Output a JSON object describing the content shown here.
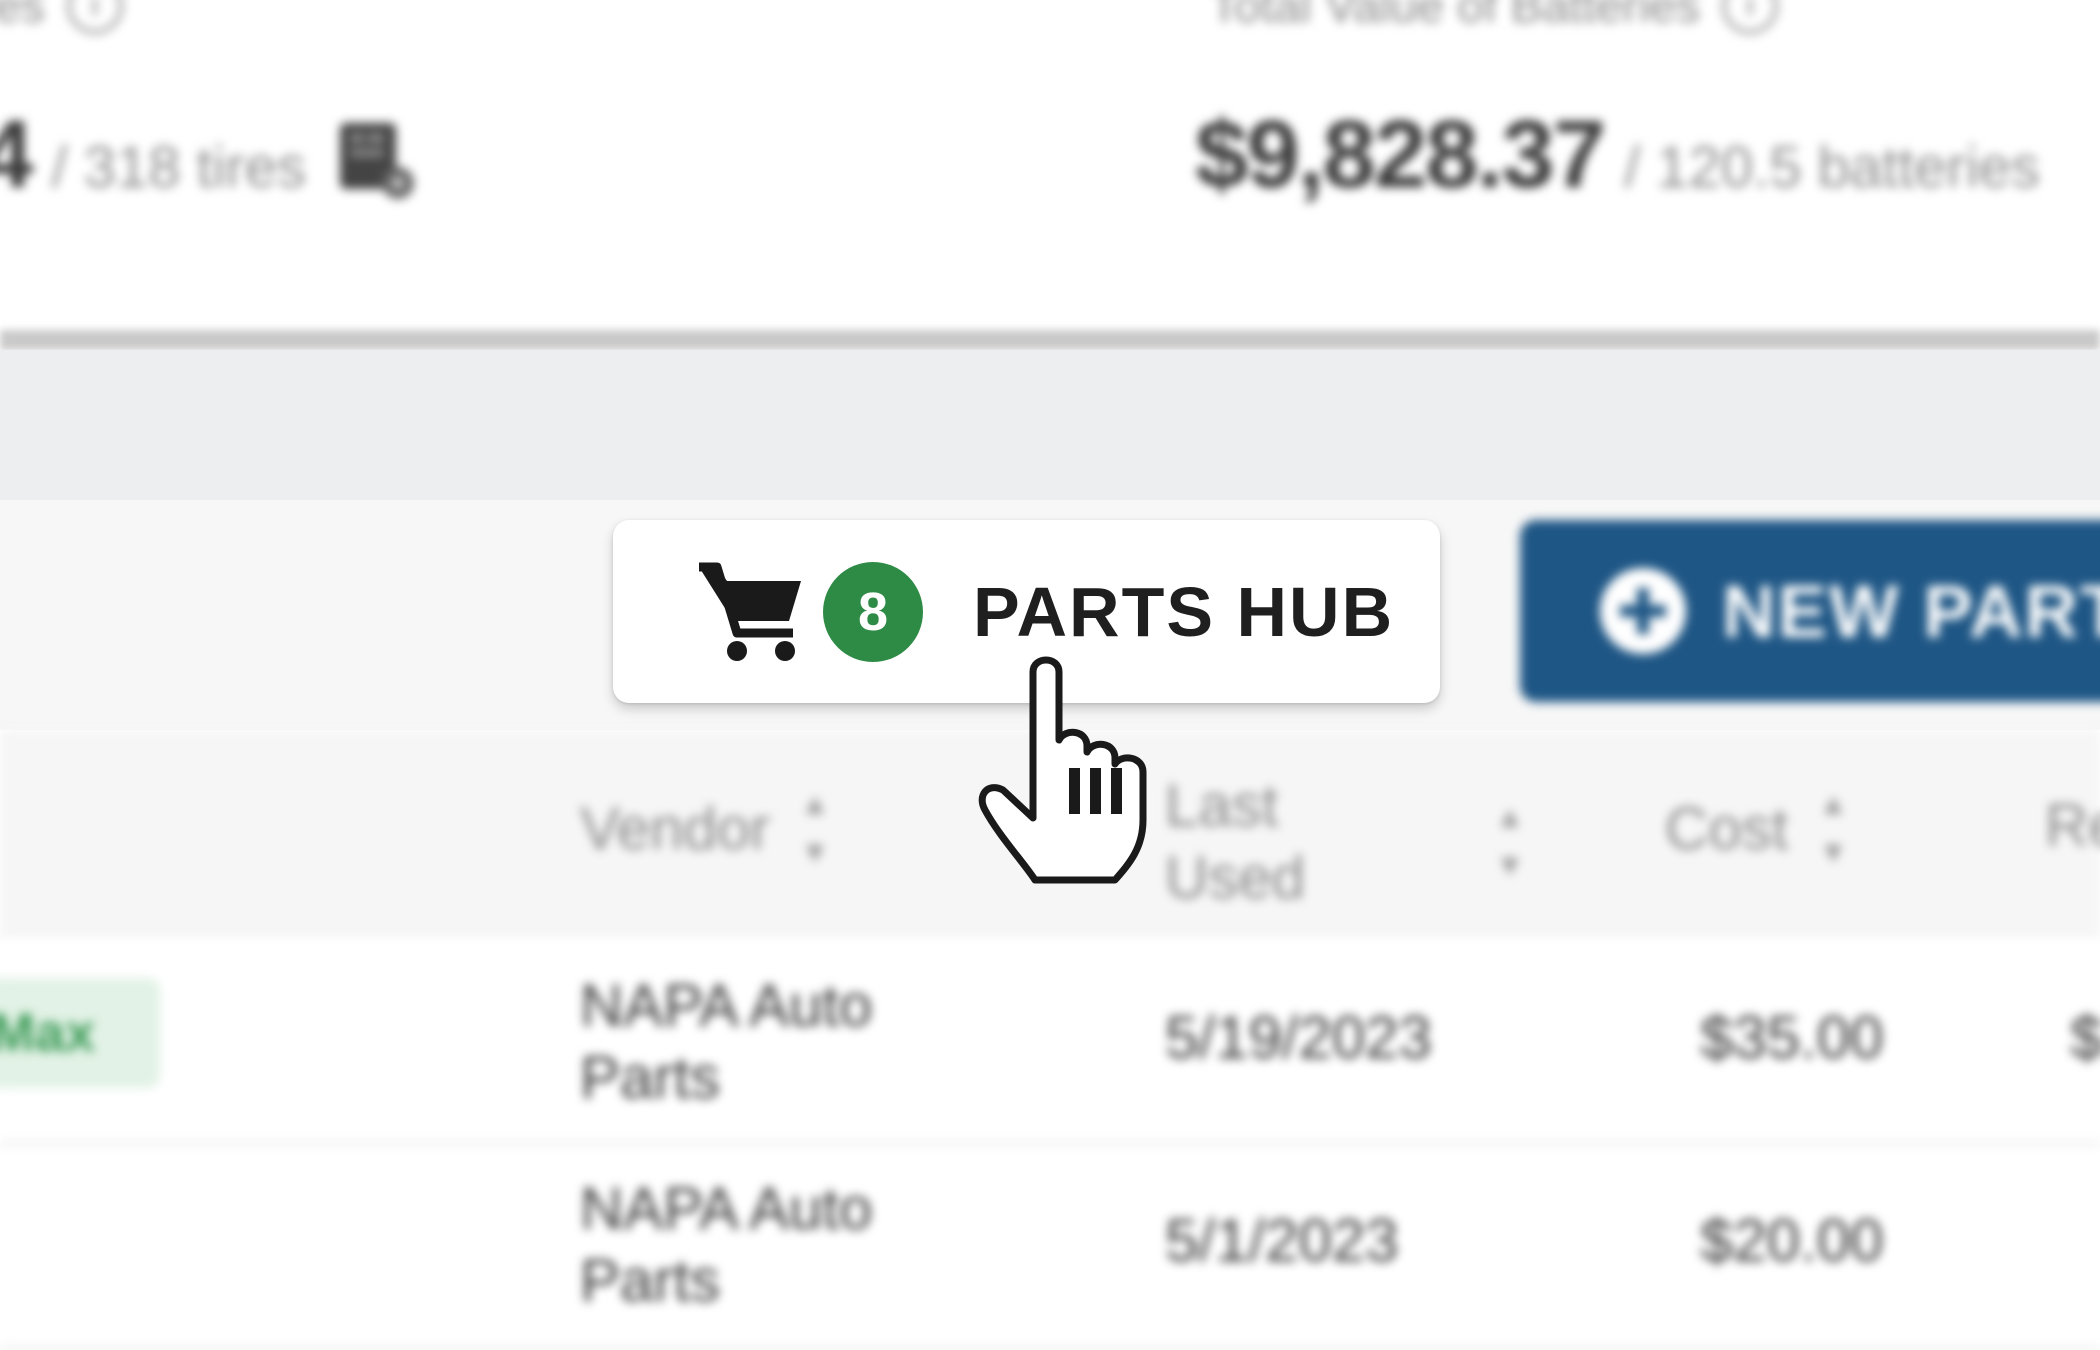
{
  "stats": {
    "tires": {
      "heading": "Tires",
      "value": "4",
      "sub": "/ 318 tires",
      "info_icon": "info-circle-icon",
      "icon": "tire-icon"
    },
    "batteries": {
      "heading": "Total Value of Batteries",
      "value": "$9,828.37",
      "sub": "/ 120.5 batteries",
      "info_icon": "info-circle-icon"
    }
  },
  "toolbar": {
    "parts_hub": {
      "label": "PARTS HUB",
      "badge_count": "8",
      "icon": "shopping-cart-icon",
      "badge_color": "#2e8b46"
    },
    "new_part": {
      "label": "NEW PART",
      "icon": "plus-circle-icon",
      "color": "#1e5685"
    }
  },
  "table": {
    "columns": [
      {
        "key": "vendor",
        "label": "Vendor"
      },
      {
        "key": "last_used",
        "label": "Last Used"
      },
      {
        "key": "cost",
        "label": "Cost"
      },
      {
        "key": "extra",
        "label": "Re"
      }
    ],
    "rows": [
      {
        "tag": "Max",
        "vendor": "NAPA Auto Parts",
        "last_used": "5/19/2023",
        "cost": "$35.00",
        "extra": "$"
      },
      {
        "tag": "",
        "vendor": "NAPA Auto Parts",
        "last_used": "5/1/2023",
        "cost": "$20.00",
        "extra": ""
      }
    ]
  },
  "cursor": {
    "icon": "pointer-hand-icon"
  }
}
